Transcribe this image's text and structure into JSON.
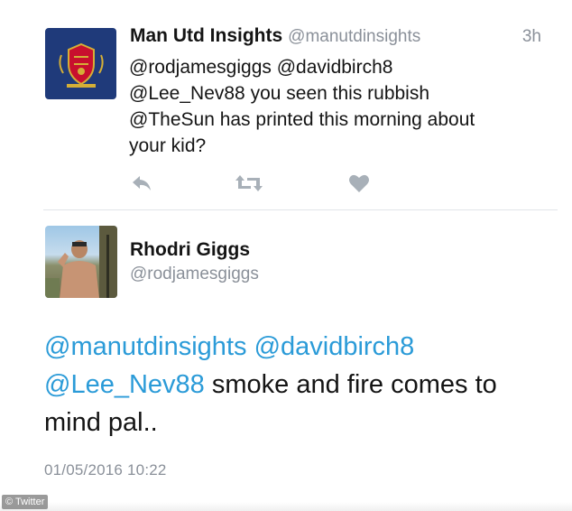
{
  "tweet1": {
    "name": "Man Utd Insights",
    "handle": "@manutdinsights",
    "time": "3h",
    "body": [
      {
        "text": "@rodjamesgiggs @davidbirch8",
        "mention": false
      },
      {
        "text": "@Lee_Nev88 you seen this rubbish",
        "mention": false
      },
      {
        "text": "@TheSun has printed this morning about",
        "mention": false
      },
      {
        "text": "your kid?",
        "mention": false
      }
    ],
    "actions": {
      "reply": "reply-icon",
      "retweet": "retweet-icon",
      "like": "heart-icon"
    },
    "avatar_color": "#1f3a7a"
  },
  "tweet2": {
    "name": "Rhodri Giggs",
    "handle": "@rodjamesgiggs",
    "body": {
      "mention1": "@manutdinsights",
      "mention2": "@davidbirch8",
      "mention3": "@Lee_Nev88",
      "text1": "smoke and fire comes to",
      "text2": "mind pal.."
    },
    "date": "01/05/2016 10:22",
    "mention_color": "#2b9bd8"
  },
  "watermark": "© Twitter"
}
